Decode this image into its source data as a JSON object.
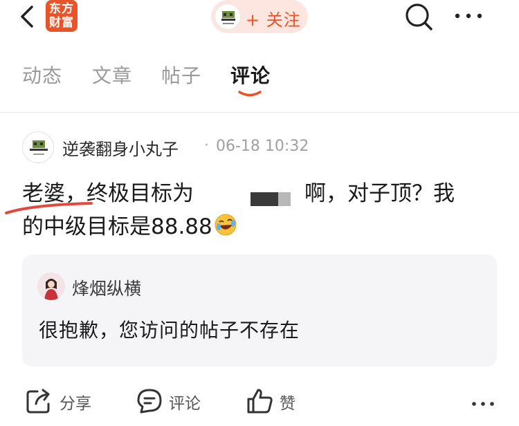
{
  "app": {
    "logo_line1": "东方",
    "logo_line2": "财富",
    "follow_label": "+ 关注"
  },
  "tabs": [
    {
      "label": "动态"
    },
    {
      "label": "文章"
    },
    {
      "label": "帖子"
    },
    {
      "label": "评论"
    }
  ],
  "active_tab": "评论",
  "comment": {
    "author": "逆袭翻身小丸子",
    "separator": "·",
    "time": "06-18 10:32",
    "line1_start": "老婆，终极目标为",
    "line1_end": "啊，对子顶？我",
    "line2": "的中级目标是88.88",
    "emoji": "rofl-emoji"
  },
  "quote": {
    "author": "烽烟纵横",
    "text": "很抱歉，您访问的帖子不存在"
  },
  "actions": {
    "share": "分享",
    "comment": "评论",
    "like": "赞"
  },
  "colors": {
    "accent": "#ef4f22",
    "pill_bg": "#fde6df",
    "quote_bg": "#f5f5f7",
    "underline": "#e5483a"
  }
}
